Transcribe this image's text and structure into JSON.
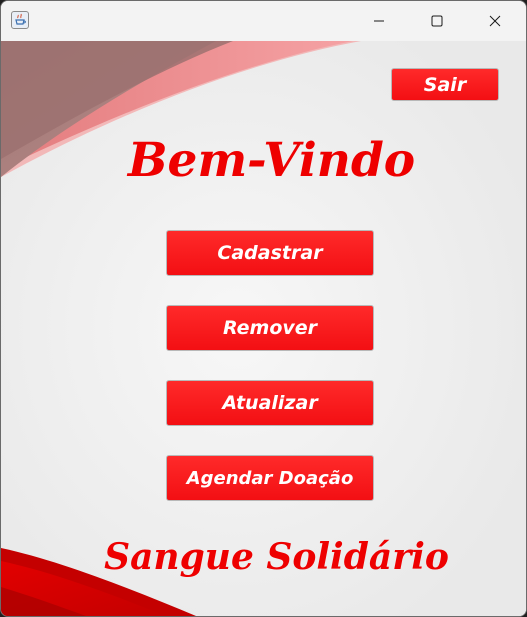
{
  "window": {
    "title": "",
    "icons": {
      "app": "java-app-icon",
      "minimize": "minimize-icon",
      "maximize": "maximize-icon",
      "close": "close-icon"
    }
  },
  "header": {
    "exit_label": "Sair"
  },
  "main": {
    "welcome": "Bem-Vindo",
    "buttons": [
      {
        "label": "Cadastrar"
      },
      {
        "label": "Remover"
      },
      {
        "label": "Atualizar"
      },
      {
        "label": "Agendar Doação"
      }
    ]
  },
  "footer": {
    "brand": "Sangue Solidário"
  },
  "colors": {
    "accent_red": "#ee0000",
    "button_red": "#f7181b",
    "button_text": "#ffffff",
    "background": "#ececec"
  }
}
